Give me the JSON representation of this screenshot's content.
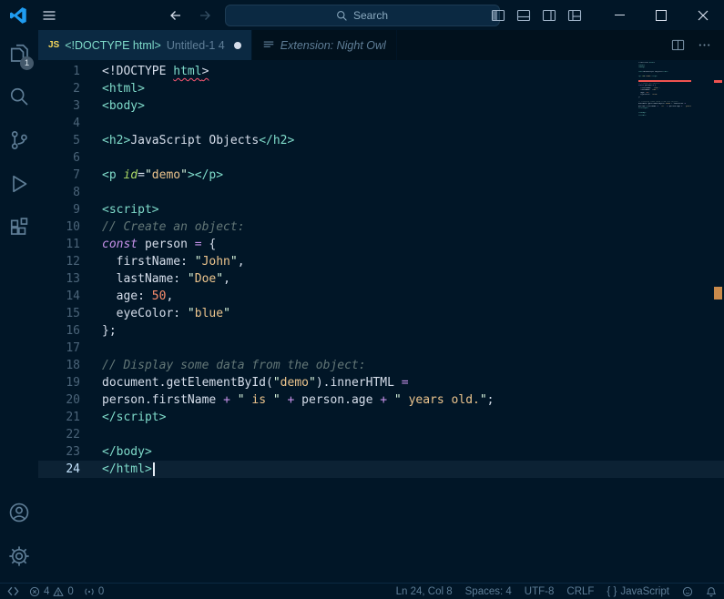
{
  "title_bar": {
    "search_placeholder": "Search"
  },
  "tabs": {
    "tab1": {
      "badge": "JS",
      "title": "<!DOCTYPE html>",
      "description": "Untitled-1 4",
      "modified": true
    },
    "tab2": {
      "title": "Extension: Night Owl"
    }
  },
  "activity_bar": {
    "explorer_badge": "1"
  },
  "editor": {
    "active_line": 24,
    "lines": [
      {
        "n": 1,
        "tokens": [
          [
            "<!DOCTYPE ",
            "fg"
          ],
          [
            "html",
            "tag",
            "err"
          ],
          [
            ">",
            "fg",
            "err"
          ]
        ]
      },
      {
        "n": 2,
        "tokens": [
          [
            "<html>",
            "tag"
          ]
        ]
      },
      {
        "n": 3,
        "tokens": [
          [
            "<body>",
            "tag"
          ]
        ]
      },
      {
        "n": 4,
        "tokens": []
      },
      {
        "n": 5,
        "tokens": [
          [
            "<h2>",
            "tag"
          ],
          [
            "JavaScript Objects",
            "fg"
          ],
          [
            "</h2>",
            "tag"
          ]
        ]
      },
      {
        "n": 6,
        "tokens": []
      },
      {
        "n": 7,
        "tokens": [
          [
            "<p ",
            "tag"
          ],
          [
            "id",
            "attr"
          ],
          [
            "=",
            "fg"
          ],
          [
            "\"",
            "strq"
          ],
          [
            "demo",
            "str"
          ],
          [
            "\"",
            "strq"
          ],
          [
            "></p>",
            "tag"
          ]
        ]
      },
      {
        "n": 8,
        "tokens": []
      },
      {
        "n": 9,
        "tokens": [
          [
            "<script>",
            "tag"
          ]
        ]
      },
      {
        "n": 10,
        "tokens": [
          [
            "// Create an object:",
            "cm"
          ]
        ]
      },
      {
        "n": 11,
        "tokens": [
          [
            "const",
            "kw"
          ],
          [
            " person ",
            "fg"
          ],
          [
            "=",
            "op"
          ],
          [
            " {",
            "fg"
          ]
        ]
      },
      {
        "n": 12,
        "tokens": [
          [
            "  firstName: ",
            "fg"
          ],
          [
            "\"",
            "strq"
          ],
          [
            "John",
            "str"
          ],
          [
            "\"",
            "strq"
          ],
          [
            ",",
            "fg"
          ]
        ]
      },
      {
        "n": 13,
        "tokens": [
          [
            "  lastName: ",
            "fg"
          ],
          [
            "\"",
            "strq"
          ],
          [
            "Doe",
            "str"
          ],
          [
            "\"",
            "strq"
          ],
          [
            ",",
            "fg"
          ]
        ]
      },
      {
        "n": 14,
        "tokens": [
          [
            "  age: ",
            "fg"
          ],
          [
            "50",
            "num"
          ],
          [
            ",",
            "fg"
          ]
        ]
      },
      {
        "n": 15,
        "tokens": [
          [
            "  eyeColor: ",
            "fg"
          ],
          [
            "\"",
            "strq"
          ],
          [
            "blue",
            "str"
          ],
          [
            "\"",
            "strq"
          ]
        ]
      },
      {
        "n": 16,
        "tokens": [
          [
            "};",
            "fg"
          ]
        ]
      },
      {
        "n": 17,
        "tokens": []
      },
      {
        "n": 18,
        "tokens": [
          [
            "// Display some data from the object:",
            "cm"
          ]
        ]
      },
      {
        "n": 19,
        "tokens": [
          [
            "document.getElementById(",
            "fg"
          ],
          [
            "\"",
            "strq"
          ],
          [
            "demo",
            "str"
          ],
          [
            "\"",
            "strq"
          ],
          [
            ").innerHTML ",
            "fg"
          ],
          [
            "=",
            "op"
          ]
        ]
      },
      {
        "n": 20,
        "tokens": [
          [
            "person.firstName ",
            "fg"
          ],
          [
            "+",
            "op"
          ],
          [
            " ",
            "fg"
          ],
          [
            "\"",
            "strq"
          ],
          [
            " is ",
            "str"
          ],
          [
            "\"",
            "strq"
          ],
          [
            " ",
            "fg"
          ],
          [
            "+",
            "op"
          ],
          [
            " person.age ",
            "fg"
          ],
          [
            "+",
            "op"
          ],
          [
            " ",
            "fg"
          ],
          [
            "\"",
            "strq"
          ],
          [
            " years old.",
            "str"
          ],
          [
            "\"",
            "strq"
          ],
          [
            ";",
            "fg"
          ]
        ]
      },
      {
        "n": 21,
        "tokens": [
          [
            "</script>",
            "tag"
          ]
        ]
      },
      {
        "n": 22,
        "tokens": []
      },
      {
        "n": 23,
        "tokens": [
          [
            "</body>",
            "tag"
          ]
        ]
      },
      {
        "n": 24,
        "tokens": [
          [
            "</html>",
            "tag"
          ]
        ]
      }
    ]
  },
  "status_bar": {
    "errors": "4",
    "warnings": "0",
    "ports": "0",
    "cursor_position": "Ln 24, Col 8",
    "indentation": "Spaces: 4",
    "encoding": "UTF-8",
    "eol": "CRLF",
    "language_icon": "{ }",
    "language": "JavaScript"
  },
  "colors": {
    "background": "#011627",
    "accent_teal": "#7fdbca",
    "string": "#ecc48d",
    "keyword": "#c792ea",
    "error": "#ef5350",
    "modified_marker": "#c98a4b"
  }
}
